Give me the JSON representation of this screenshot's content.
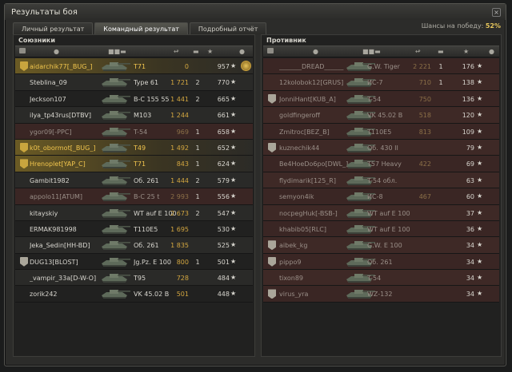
{
  "window": {
    "title": "Результаты боя",
    "close_glyph": "×"
  },
  "tabs": [
    {
      "label": "Личный результат",
      "active": false
    },
    {
      "label": "Командный результат",
      "active": true
    },
    {
      "label": "Подробный отчёт",
      "active": false
    }
  ],
  "win_chance": {
    "label": "Шансы на победу:",
    "value": "52%"
  },
  "allies": {
    "title": "Союзники",
    "rows": [
      {
        "player": "aidarchik77[_BUG_]",
        "tank": "T71",
        "damage": "0",
        "frags": "",
        "xp": "957",
        "me": true,
        "platoon": true,
        "medal": true,
        "dead": false
      },
      {
        "player": "Steblina_09",
        "tank": "Type 61",
        "damage": "1 721",
        "frags": "2",
        "xp": "770",
        "me": false,
        "platoon": false,
        "dead": false
      },
      {
        "player": "Jeckson107",
        "tank": "B-C 155 55",
        "damage": "1 441",
        "frags": "2",
        "xp": "665",
        "me": false,
        "platoon": false,
        "dead": false
      },
      {
        "player": "ilya_tp43rus[DTBV]",
        "tank": "M103",
        "damage": "1 244",
        "frags": "",
        "xp": "661",
        "me": false,
        "platoon": false,
        "dead": false
      },
      {
        "player": "ygor09[-PPC]",
        "tank": "T-54",
        "damage": "969",
        "frags": "1",
        "xp": "658",
        "me": false,
        "platoon": false,
        "dead": true
      },
      {
        "player": "k0t_obormot[_BUG_]",
        "tank": "T49",
        "damage": "1 492",
        "frags": "1",
        "xp": "652",
        "me": true,
        "platoon": true,
        "dead": false
      },
      {
        "player": "Hrenoplet[YAP_C]",
        "tank": "T71",
        "damage": "843",
        "frags": "1",
        "xp": "624",
        "me": true,
        "platoon": true,
        "dead": false
      },
      {
        "player": "Gambit1982",
        "tank": "Об. 261",
        "damage": "1 444",
        "frags": "2",
        "xp": "579",
        "me": false,
        "platoon": false,
        "dead": false
      },
      {
        "player": "appolo11[ATUM]",
        "tank": "B-C 25 t",
        "damage": "2 993",
        "frags": "1",
        "xp": "556",
        "me": false,
        "platoon": false,
        "dead": true
      },
      {
        "player": "kitayskiy",
        "tank": "WT auf E 100",
        "damage": "2 673",
        "frags": "2",
        "xp": "547",
        "me": false,
        "platoon": false,
        "dead": false
      },
      {
        "player": "ERMAK981998",
        "tank": "T110E5",
        "damage": "1 695",
        "frags": "",
        "xp": "530",
        "me": false,
        "platoon": false,
        "dead": false
      },
      {
        "player": "Jeka_Sedin[HH-BD]",
        "tank": "Об. 261",
        "damage": "1 835",
        "frags": "",
        "xp": "525",
        "me": false,
        "platoon": false,
        "dead": false
      },
      {
        "player": "DUG13[BLOST]",
        "tank": "Jg.Pz. E 100",
        "damage": "800",
        "frags": "1",
        "xp": "501",
        "me": false,
        "platoon": true,
        "dead": false
      },
      {
        "player": "_vampir_33a[D-W-O]",
        "tank": "T95",
        "damage": "728",
        "frags": "",
        "xp": "484",
        "me": false,
        "platoon": false,
        "dead": false
      },
      {
        "player": "zorik242",
        "tank": "VK 45.02 B",
        "damage": "501",
        "frags": "",
        "xp": "448",
        "me": false,
        "platoon": false,
        "dead": false
      }
    ]
  },
  "enemies": {
    "title": "Противник",
    "rows": [
      {
        "player": "_______DREAD______",
        "tank": "G.W. Tiger",
        "damage": "2 221",
        "frags": "1",
        "xp": "176",
        "platoon": false,
        "dead": true
      },
      {
        "player": "12kolobok12[GRUS]",
        "tank": "ИС-7",
        "damage": "710",
        "frags": "1",
        "xp": "138",
        "platoon": false,
        "dead": true
      },
      {
        "player": "JonniHant[KUB_A]",
        "tank": "T-54",
        "damage": "750",
        "frags": "",
        "xp": "136",
        "platoon": true,
        "dead": true
      },
      {
        "player": "goldfingeroff",
        "tank": "VK 45.02 B",
        "damage": "518",
        "frags": "",
        "xp": "120",
        "platoon": false,
        "dead": true
      },
      {
        "player": "Zmitroc[BEZ_B]",
        "tank": "T110E5",
        "damage": "813",
        "frags": "",
        "xp": "109",
        "platoon": false,
        "dead": true
      },
      {
        "player": "kuznechik44",
        "tank": "Об. 430 II",
        "damage": "",
        "frags": "",
        "xp": "79",
        "platoon": true,
        "dead": true
      },
      {
        "player": "Be4HoeDo6po[DWL_]",
        "tank": "T57 Heavy",
        "damage": "422",
        "frags": "",
        "xp": "69",
        "platoon": false,
        "dead": true
      },
      {
        "player": "flydimarik[125_R]",
        "tank": "T-54 обл.",
        "damage": "",
        "frags": "",
        "xp": "63",
        "platoon": false,
        "dead": true
      },
      {
        "player": "semyon4ik",
        "tank": "ИС-8",
        "damage": "467",
        "frags": "",
        "xp": "60",
        "platoon": false,
        "dead": true
      },
      {
        "player": "nocpegHuk[-BSB-]",
        "tank": "WT auf E 100",
        "damage": "",
        "frags": "",
        "xp": "37",
        "platoon": false,
        "dead": true
      },
      {
        "player": "khabib05[RLC]",
        "tank": "WT auf E 100",
        "damage": "",
        "frags": "",
        "xp": "36",
        "platoon": false,
        "dead": true
      },
      {
        "player": "aibek_kg",
        "tank": "G.W. E 100",
        "damage": "",
        "frags": "",
        "xp": "34",
        "platoon": true,
        "dead": true
      },
      {
        "player": "pippo9",
        "tank": "Об. 261",
        "damage": "",
        "frags": "",
        "xp": "34",
        "platoon": true,
        "dead": true
      },
      {
        "player": "tixon89",
        "tank": "T-54",
        "damage": "",
        "frags": "",
        "xp": "34",
        "platoon": false,
        "dead": true
      },
      {
        "player": "virus_yra",
        "tank": "WZ-132",
        "damage": "",
        "frags": "",
        "xp": "34",
        "platoon": true,
        "dead": true
      }
    ]
  },
  "colors": {
    "accent_gold": "#e7c65c",
    "dead_row": "#3a2624",
    "self_row": "#6a5a24"
  },
  "icons": {
    "xp_icon": "star-icon",
    "platoon_icon": "platoon-badge-icon",
    "medal_icon": "medal-icon"
  }
}
